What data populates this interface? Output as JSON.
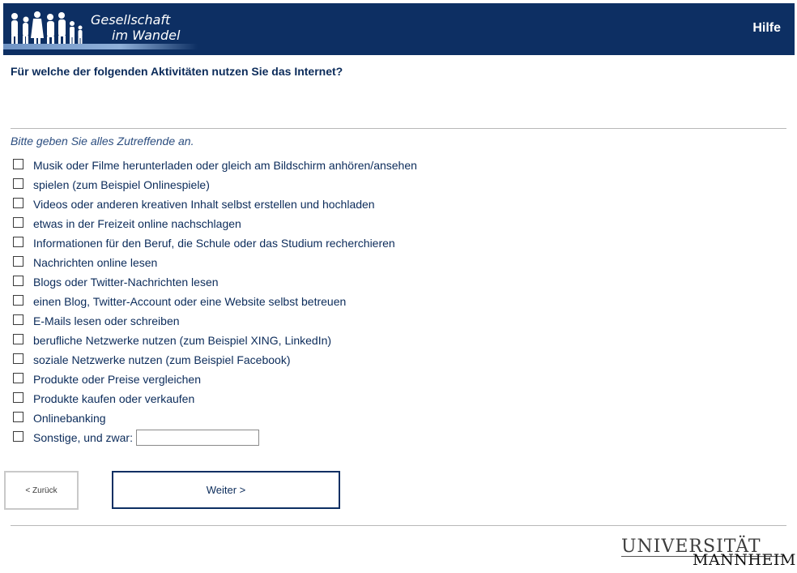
{
  "header": {
    "logo_line1": "Gesellschaft",
    "logo_line2": "im Wandel",
    "help_label": "Hilfe",
    "background_color": "#0d2f63"
  },
  "question": {
    "title": "Für welche der folgenden Aktivitäten nutzen Sie das Internet?",
    "instruction": "Bitte geben Sie alles Zutreffende an."
  },
  "options": [
    {
      "label": "Musik oder Filme herunterladen oder gleich am Bildschirm anhören/ansehen",
      "checked": false
    },
    {
      "label": "spielen (zum Beispiel Onlinespiele)",
      "checked": false
    },
    {
      "label": "Videos oder anderen kreativen Inhalt selbst erstellen und hochladen",
      "checked": false
    },
    {
      "label": "etwas in der Freizeit online nachschlagen",
      "checked": false
    },
    {
      "label": "Informationen für den Beruf, die Schule oder das Studium recherchieren",
      "checked": false
    },
    {
      "label": "Nachrichten online lesen",
      "checked": false
    },
    {
      "label": "Blogs oder Twitter-Nachrichten lesen",
      "checked": false
    },
    {
      "label": "einen Blog, Twitter-Account oder eine Website selbst betreuen",
      "checked": false
    },
    {
      "label": "E-Mails lesen oder schreiben",
      "checked": false
    },
    {
      "label": "berufliche Netzwerke nutzen (zum Beispiel XING, LinkedIn)",
      "checked": false
    },
    {
      "label": "soziale Netzwerke nutzen (zum Beispiel Facebook)",
      "checked": false
    },
    {
      "label": "Produkte oder Preise vergleichen",
      "checked": false
    },
    {
      "label": "Produkte kaufen oder verkaufen",
      "checked": false
    },
    {
      "label": "Onlinebanking",
      "checked": false
    }
  ],
  "other_option": {
    "label": "Sonstige, und zwar:",
    "value": ""
  },
  "navigation": {
    "back_label": "< Zurück",
    "next_label": "Weiter >"
  },
  "footer": {
    "logo_top": "UNIVERSITÄT",
    "logo_bottom": "MANNHEIM"
  }
}
